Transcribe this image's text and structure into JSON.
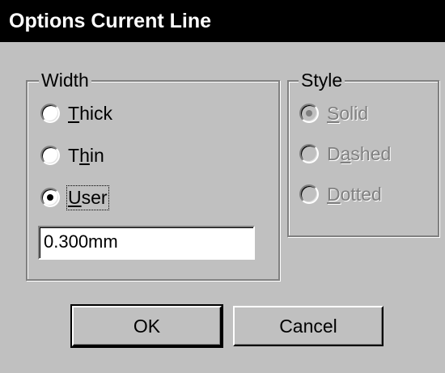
{
  "window": {
    "title": "Options Current Line"
  },
  "width_group": {
    "legend": "Width",
    "options": [
      {
        "underline": "T",
        "rest": "hick",
        "checked": false
      },
      {
        "before": "T",
        "underline": "h",
        "rest": "in",
        "checked": false
      },
      {
        "underline": "U",
        "rest": "ser",
        "checked": true
      }
    ],
    "user_value": "0.300mm"
  },
  "style_group": {
    "legend": "Style",
    "enabled": false,
    "options": [
      {
        "underline": "S",
        "rest": "olid",
        "checked": true
      },
      {
        "before": "D",
        "underline": "a",
        "rest": "shed",
        "checked": false
      },
      {
        "underline": "D",
        "rest": "otted",
        "checked": false
      }
    ]
  },
  "buttons": {
    "ok": "OK",
    "cancel": "Cancel"
  }
}
